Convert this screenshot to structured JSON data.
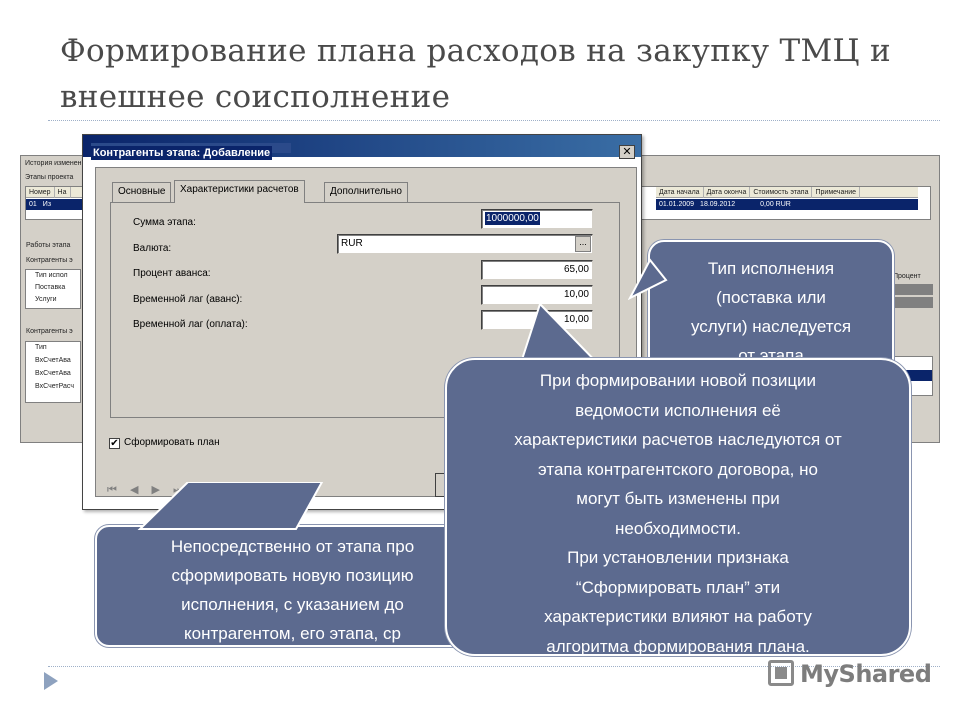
{
  "slide": {
    "title_line1": "Формирование плана расходов на закупку ТМЦ и",
    "title_line2": "внешнее соисполнение",
    "watermark": "MyShared"
  },
  "background_app": {
    "history_label": "История изменен",
    "stages_label": "Этапы проекта",
    "col_number": "Номер",
    "col_name_fragment": "На",
    "row_number": "01",
    "row_name_fragment": "Из",
    "col_start_date": "Дата начала",
    "col_end_date": "Дата оконча",
    "col_cost": "Стоимость этапа",
    "col_note": "Примечание",
    "row_start_date": "01.01.2009",
    "row_end_date": "18.09.2012",
    "row_cost": "0,00 RUR",
    "stage_works_label": "Работы этапа",
    "contractors_label": "Контрагенты э",
    "type_header": "Тип испол",
    "row_supply": "Поставка",
    "row_services": "Услуги",
    "contractors_stages_label": "Контрагенты э",
    "type_col": "Тип",
    "invoice1": "ВхСчетАва",
    "invoice2": "ВхСчетАва",
    "invoice3": "ВхСчетРасч",
    "percent_header": "Процент",
    "dots": "..."
  },
  "dialog": {
    "title": "Контрагенты этапа: Добавление",
    "close_glyph": "✕",
    "tabs": [
      {
        "label": "Основные",
        "active": false
      },
      {
        "label": "Характеристики расчетов",
        "active": true
      },
      {
        "label": "Дополнительно",
        "active": false
      }
    ],
    "fields": {
      "sum_label": "Сумма этапа:",
      "sum_value": "1000000,00",
      "currency_label": "Валюта:",
      "currency_value": "RUR",
      "advance_percent_label": "Процент аванса:",
      "advance_percent_value": "65,00",
      "lag_advance_label": "Временной лаг (аванс):",
      "lag_advance_value": "10,00",
      "lag_payment_label": "Временной лаг (оплата):",
      "lag_payment_value": "10,00"
    },
    "checkbox": {
      "label": "Сформировать план",
      "checked": true,
      "mark": "✔"
    },
    "nav": {
      "first": "⏮",
      "prev": "◀",
      "next": "▶",
      "last": "⏭",
      "add": "✚",
      "add_copy": "⊞",
      "delete": "✕"
    },
    "ellipsis": "..."
  },
  "callouts": {
    "right_top": [
      "Тип исполнения",
      "(поставка или",
      "услуги) наследуется",
      "от этапа"
    ],
    "bottom_left": [
      "Непосредственно от этапа про",
      "сформировать новую позицию",
      "исполнения, с указанием до",
      "контрагентом, его этапа, ср"
    ],
    "main": [
      "При формировании новой позиции",
      "ведомости исполнения её",
      "характеристики расчетов наследуются от",
      "этапа контрагентского договора, но",
      "могут быть изменены при",
      "необходимости.",
      "При установлении признака",
      "“Сформировать план” эти",
      "характеристики влияют на работу",
      "алгоритма формирования плана."
    ]
  },
  "colors": {
    "callout_fill": "#5c6a8f",
    "title_text": "#4a4a4a",
    "titlebar": "#0a246a"
  }
}
